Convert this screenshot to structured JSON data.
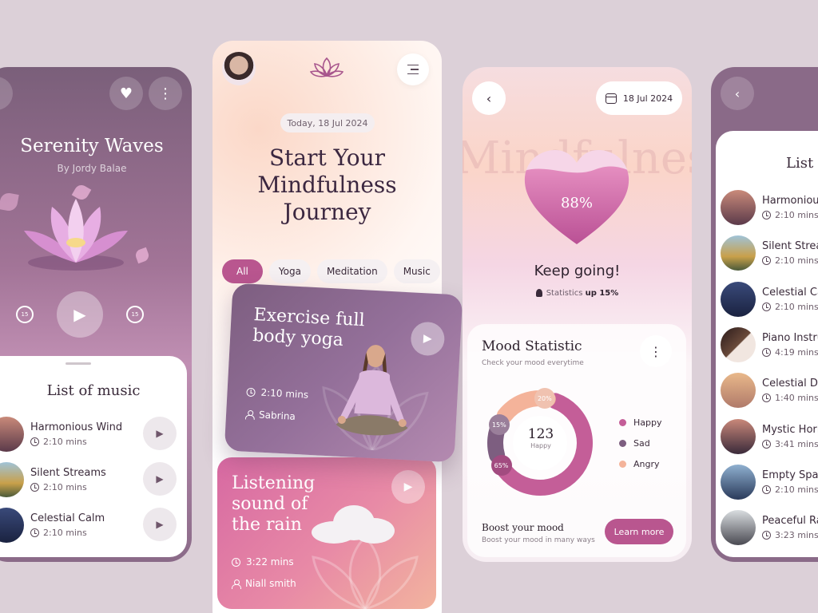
{
  "colors": {
    "accent": "#b9568f",
    "plum": "#7d5e80",
    "peach": "#f4b39a",
    "background": "#dcd0d8"
  },
  "player": {
    "title": "Serenity Waves",
    "artist": "By Jordy Balae",
    "skip_back": "15",
    "skip_forward": "15",
    "list_title": "List of music",
    "tracks": [
      {
        "name": "Harmonious Wind",
        "duration": "2:10 mins"
      },
      {
        "name": "Silent Streams",
        "duration": "2:10 mins"
      },
      {
        "name": "Celestial Calm",
        "duration": "2:10 mins"
      }
    ]
  },
  "home": {
    "date": "Today, 18 Jul 2024",
    "headline_lines": [
      "Start Your",
      "Mindfulness",
      "Journey"
    ],
    "chips": [
      "All",
      "Yoga",
      "Meditation",
      "Music"
    ],
    "cards": [
      {
        "title_lines": [
          "Exercise full",
          "body yoga"
        ],
        "duration": "2:10 mins",
        "author": "Sabrina"
      },
      {
        "title_lines": [
          "Listening",
          "sound of",
          "the rain"
        ],
        "duration": "3:22 mins",
        "author": "Niall smith"
      }
    ]
  },
  "stats": {
    "date": "18 Jul 2024",
    "background_word": "Mindfulness",
    "heart_percent": "88%",
    "heart_fill": 0.88,
    "message": "Keep going!",
    "statistics_label": "Statistics",
    "statistics_value": "up 15%",
    "mood_title": "Mood Statistic",
    "mood_subtitle": "Check your mood everytime",
    "center_value": "123",
    "center_label": "Happy",
    "boost_title": "Boost your mood",
    "boost_subtitle": "Boost your mood in many ways",
    "learn_more": "Learn more"
  },
  "chart_data": {
    "type": "pie",
    "categories": [
      "Happy",
      "Sad",
      "Angry"
    ],
    "values": [
      65,
      15,
      20
    ],
    "labels": [
      "65%",
      "15%",
      "20%"
    ],
    "colors": [
      "#c45e98",
      "#7d5e80",
      "#f4b39a"
    ],
    "center_value": "123",
    "center_label": "Happy"
  },
  "list": {
    "title": "List of music",
    "tracks": [
      {
        "name": "Harmonious Wind",
        "duration": "2:10 mins"
      },
      {
        "name": "Silent Streams",
        "duration": "2:10 mins"
      },
      {
        "name": "Celestial Calm",
        "duration": "2:10 mins"
      },
      {
        "name": "Piano Instrumental",
        "duration": "4:19 mins"
      },
      {
        "name": "Celestial Drift",
        "duration": "1:40 mins"
      },
      {
        "name": "Mystic Horizon",
        "duration": "3:41 mins"
      },
      {
        "name": "Empty Space",
        "duration": "2:10 mins"
      },
      {
        "name": "Peaceful Rain",
        "duration": "3:23 mins"
      }
    ]
  }
}
